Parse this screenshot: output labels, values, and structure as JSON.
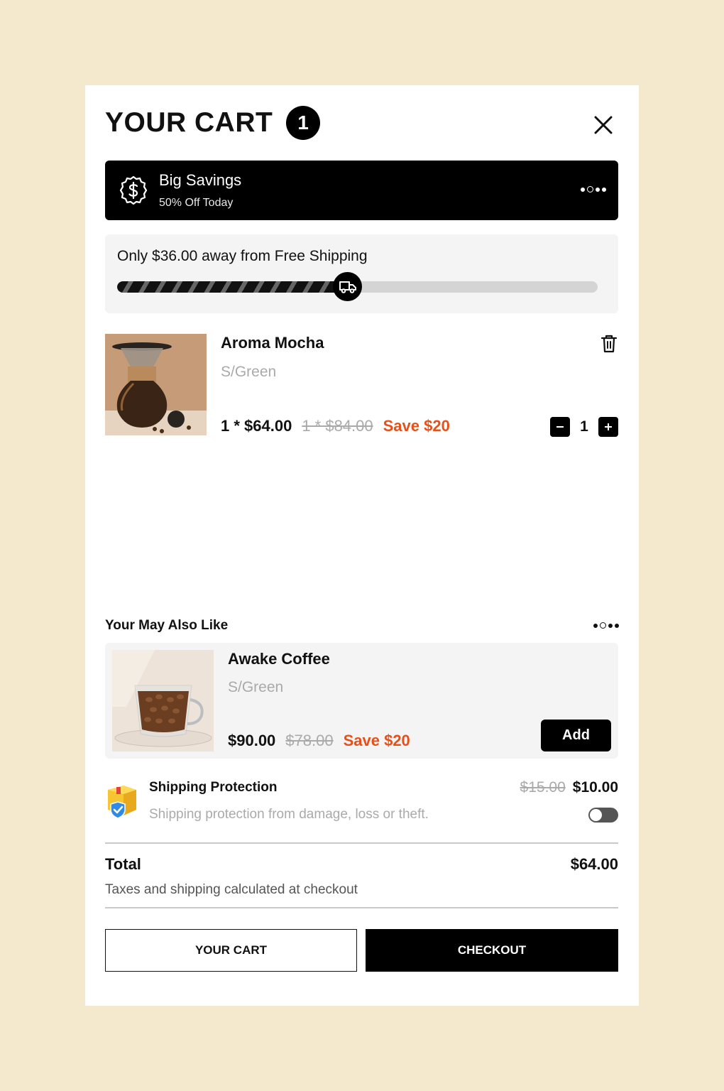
{
  "header": {
    "title": "YOUR CART",
    "count": "1"
  },
  "promo": {
    "title": "Big Savings",
    "subtitle": "50% Off Today",
    "icon": "dollar-badge-icon"
  },
  "shipping_progress": {
    "message": "Only $36.00 away from Free Shipping",
    "progress": 0.48,
    "icon": "truck-icon"
  },
  "cart_items": [
    {
      "name": "Aroma Mocha",
      "variant": "S/Green",
      "price": "1 * $64.00",
      "compare_price": "1 * $84.00",
      "savings": "Save $20",
      "quantity": "1"
    }
  ],
  "recommendations": {
    "title": "Your May Also Like",
    "items": [
      {
        "name": "Awake Coffee",
        "variant": "S/Green",
        "price": "$90.00",
        "compare_price": "$78.00",
        "savings": "Save $20",
        "add_label": "Add"
      }
    ]
  },
  "shipping_protection": {
    "title": "Shipping Protection",
    "description": "Shipping protection from damage, loss or theft.",
    "old_price": "$15.00",
    "price": "$10.00",
    "enabled": false
  },
  "summary": {
    "total_label": "Total",
    "total_value": "$64.00",
    "note": "Taxes and shipping calculated at checkout"
  },
  "actions": {
    "cart_label": "YOUR CART",
    "checkout_label": "CHECKOUT"
  },
  "colors": {
    "background": "#f5e9cd",
    "accent_savings": "#e8501a",
    "primary": "#000000"
  }
}
